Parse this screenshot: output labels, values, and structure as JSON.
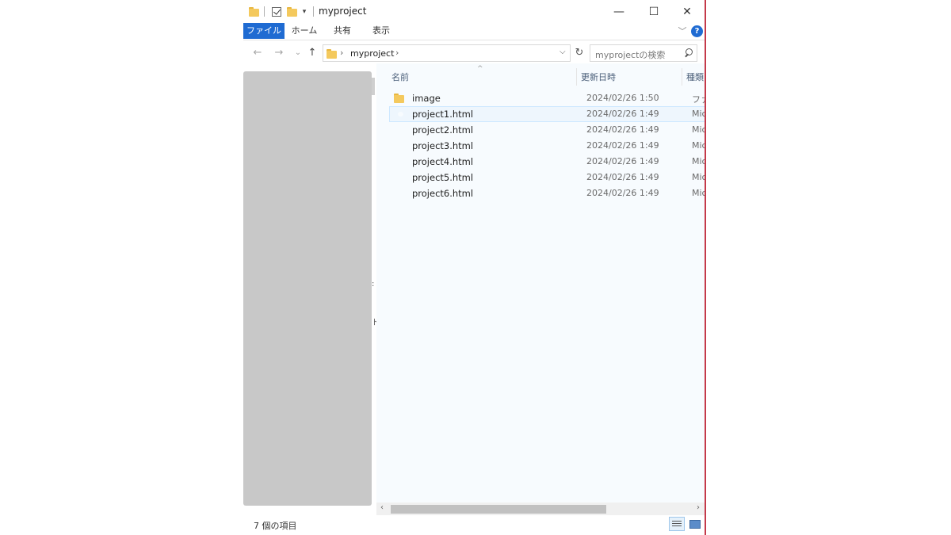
{
  "window": {
    "title": "myproject",
    "minimize_glyph": "—",
    "maximize_glyph": "☐",
    "close_glyph": "✕"
  },
  "ribbon": {
    "tabs": [
      {
        "label": "ファイル"
      },
      {
        "label": "ホーム"
      },
      {
        "label": "共有"
      },
      {
        "label": "表示"
      }
    ],
    "help_label": "?",
    "collapse_glyph": "﹀"
  },
  "navigation": {
    "back_glyph": "←",
    "forward_glyph": "→",
    "recent_glyph": "⌄",
    "up_glyph": "↑",
    "breadcrumb": "myproject",
    "crumb_separator": "›",
    "dropdown_glyph": "⌵",
    "refresh_glyph": "↻"
  },
  "search": {
    "placeholder": "myprojectの検索"
  },
  "columns": {
    "name": "名前",
    "date": "更新日時",
    "type": "種類"
  },
  "sort_caret": "^",
  "files": [
    {
      "name": "image",
      "date": "2024/02/26 1:50",
      "type": "ファイ",
      "icon": "folder-icon"
    },
    {
      "name": "project1.html",
      "date": "2024/02/26 1:49",
      "type": "Micro",
      "icon": "edge-icon"
    },
    {
      "name": "project2.html",
      "date": "2024/02/26 1:49",
      "type": "Micro",
      "icon": "edge-icon"
    },
    {
      "name": "project3.html",
      "date": "2024/02/26 1:49",
      "type": "Micro",
      "icon": "edge-icon"
    },
    {
      "name": "project4.html",
      "date": "2024/02/26 1:49",
      "type": "Micro",
      "icon": "edge-icon"
    },
    {
      "name": "project5.html",
      "date": "2024/02/26 1:49",
      "type": "Micro",
      "icon": "edge-icon"
    },
    {
      "name": "project6.html",
      "date": "2024/02/26 1:49",
      "type": "Micro",
      "icon": "edge-icon"
    }
  ],
  "scrollbar": {
    "left_glyph": "‹",
    "right_glyph": "›"
  },
  "status": {
    "item_count": "7 個の項目"
  },
  "navpane_edge_marks": [
    ":",
    "ド"
  ],
  "colors": {
    "accent": "#1f6bd2",
    "selection_border": "#cde8ff",
    "window_border": "#c43a4a"
  }
}
